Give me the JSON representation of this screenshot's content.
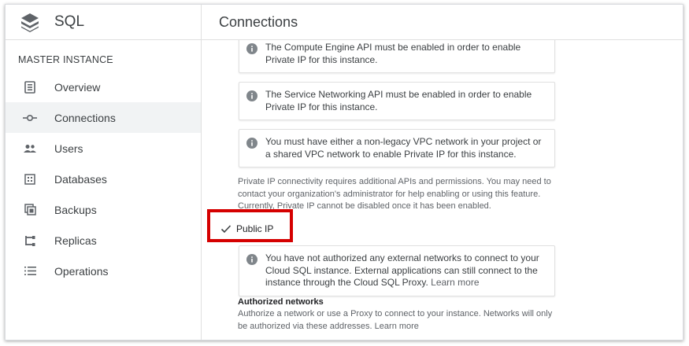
{
  "sidebar": {
    "title": "SQL",
    "section": "MASTER INSTANCE",
    "items": [
      {
        "label": "Overview",
        "icon": "overview-icon"
      },
      {
        "label": "Connections",
        "icon": "connections-icon",
        "active": true
      },
      {
        "label": "Users",
        "icon": "users-icon"
      },
      {
        "label": "Databases",
        "icon": "databases-icon"
      },
      {
        "label": "Backups",
        "icon": "backups-icon"
      },
      {
        "label": "Replicas",
        "icon": "replicas-icon"
      },
      {
        "label": "Operations",
        "icon": "operations-icon"
      }
    ]
  },
  "main": {
    "title": "Connections",
    "notices": [
      {
        "text": "The Compute Engine API must be enabled in order to enable Private IP for this instance."
      },
      {
        "text": "The Service Networking API must be enabled in order to enable Private IP for this instance."
      },
      {
        "text": "You must have either a non-legacy VPC network in your project or a shared VPC network to enable Private IP for this instance."
      }
    ],
    "private_ip_help": "Private IP connectivity requires additional APIs and permissions. You may need to contact your organization's administrator for help enabling or using this feature. Currently, Private IP cannot be disabled once it has been enabled.",
    "public_ip": {
      "label": "Public IP",
      "checked": true
    },
    "public_notice": {
      "text": "You have not authorized any external networks to connect to your Cloud SQL instance. External applications can still connect to the instance through the Cloud SQL Proxy.",
      "link": "Learn more"
    },
    "authorized_networks": {
      "heading": "Authorized networks",
      "description": "Authorize a network or use a Proxy to connect to your instance. Networks will only be authorized via these addresses.",
      "link": "Learn more"
    }
  },
  "colors": {
    "highlight": "#d50000",
    "active_bg": "#f1f3f4"
  }
}
